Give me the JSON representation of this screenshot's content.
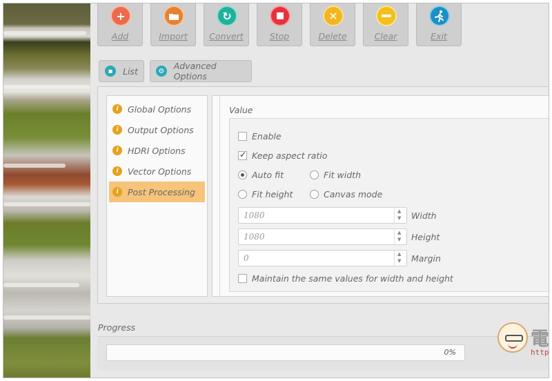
{
  "toolbar": {
    "buttons": [
      {
        "label": "Add",
        "icon": "plus-icon",
        "color": "#ef6a4a",
        "glyph": "+"
      },
      {
        "label": "Import",
        "icon": "folder-icon",
        "color": "#e8812f",
        "glyph": "▬"
      },
      {
        "label": "Convert",
        "icon": "refresh-icon",
        "color": "#1fb29a",
        "glyph": "↻"
      },
      {
        "label": "Stop",
        "icon": "stop-icon",
        "color": "#e9313c",
        "glyph": "■"
      },
      {
        "label": "Delete",
        "icon": "close-icon",
        "color": "#f3b61f",
        "glyph": "✕"
      },
      {
        "label": "Clear",
        "icon": "minus-icon",
        "color": "#f3bf1a",
        "glyph": "−"
      },
      {
        "label": "Exit",
        "icon": "running-man-icon",
        "color": "#1b90c7",
        "glyph": "🏃"
      }
    ]
  },
  "tabs": {
    "list": {
      "label": "List",
      "icon": "list-icon"
    },
    "advanced": {
      "label": "Advanced Options",
      "icon": "gear-icon"
    }
  },
  "sidebar": {
    "items": [
      {
        "label": "Global Options",
        "selected": false
      },
      {
        "label": "Output Options",
        "selected": false
      },
      {
        "label": "HDRI Options",
        "selected": false
      },
      {
        "label": "Vector Options",
        "selected": false
      },
      {
        "label": "Post Processing",
        "selected": true
      }
    ]
  },
  "options": {
    "group_title": "Value",
    "enable": {
      "label": "Enable",
      "checked": false
    },
    "keep_aspect": {
      "label": "Keep aspect ratio",
      "checked": true
    },
    "radios": {
      "auto_fit": {
        "label": "Auto fit",
        "selected": true
      },
      "fit_width": {
        "label": "Fit width",
        "selected": false
      },
      "fit_height": {
        "label": "Fit height",
        "selected": false
      },
      "canvas_mode": {
        "label": "Canvas mode",
        "selected": false
      }
    },
    "width": {
      "value": "1080",
      "label": "Width"
    },
    "height": {
      "value": "1080",
      "label": "Height"
    },
    "margin": {
      "value": "0",
      "label": "Margin"
    },
    "maintain": {
      "label": "Maintain the same values for width and height",
      "checked": false
    }
  },
  "progress": {
    "label": "Progress",
    "value": 0,
    "text": "0%"
  },
  "watermark": {
    "brand": "電腦王阿達",
    "url": "http://www.kocpc.com.tw"
  },
  "colors": {
    "accent_selected": "#f6c47a",
    "list_bullet": "#e7a21c",
    "tab_icon": "#2aa9b5"
  }
}
